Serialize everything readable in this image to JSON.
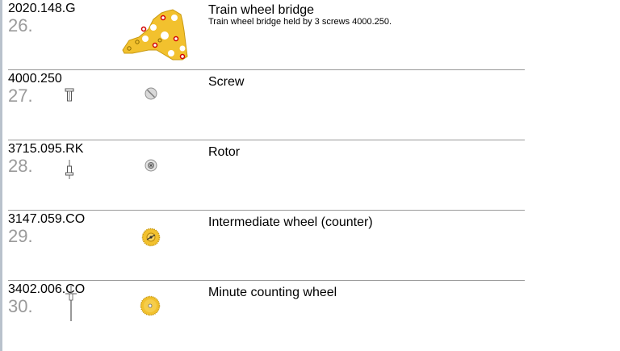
{
  "parts": [
    {
      "ref": "2020.148.G",
      "number": "26.",
      "title": "Train wheel bridge",
      "description": "Train wheel bridge held by 3 screws 4000.250.",
      "image_icon": "bridge-icon",
      "tool_icon": "",
      "color": "#f2c12e"
    },
    {
      "ref": "4000.250",
      "number": "27.",
      "title": "Screw",
      "description": "",
      "image_icon": "screw-icon",
      "tool_icon": "screwdriver-icon",
      "color": "#d9d9d9"
    },
    {
      "ref": "3715.095.RK",
      "number": "28.",
      "title": "Rotor",
      "description": "",
      "image_icon": "rotor-icon",
      "tool_icon": "tweezers-icon",
      "color": "#d9d9d9"
    },
    {
      "ref": "3147.059.CO",
      "number": "29.",
      "title": "Intermediate wheel (counter)",
      "description": "",
      "image_icon": "intermediate-wheel-icon",
      "tool_icon": "",
      "color": "#f2c12e"
    },
    {
      "ref": "3402.006.CO",
      "number": "30.",
      "title": "Minute counting wheel",
      "description": "",
      "image_icon": "minute-counting-wheel-icon",
      "tool_icon": "pin-tool-icon",
      "color": "#f2c12e"
    }
  ],
  "colors": {
    "bridge": "#f2c12e",
    "bridge-hole": "#ffffff",
    "screw-head": "#d10000",
    "number": "#9a9a9a",
    "divider": "#999999"
  }
}
